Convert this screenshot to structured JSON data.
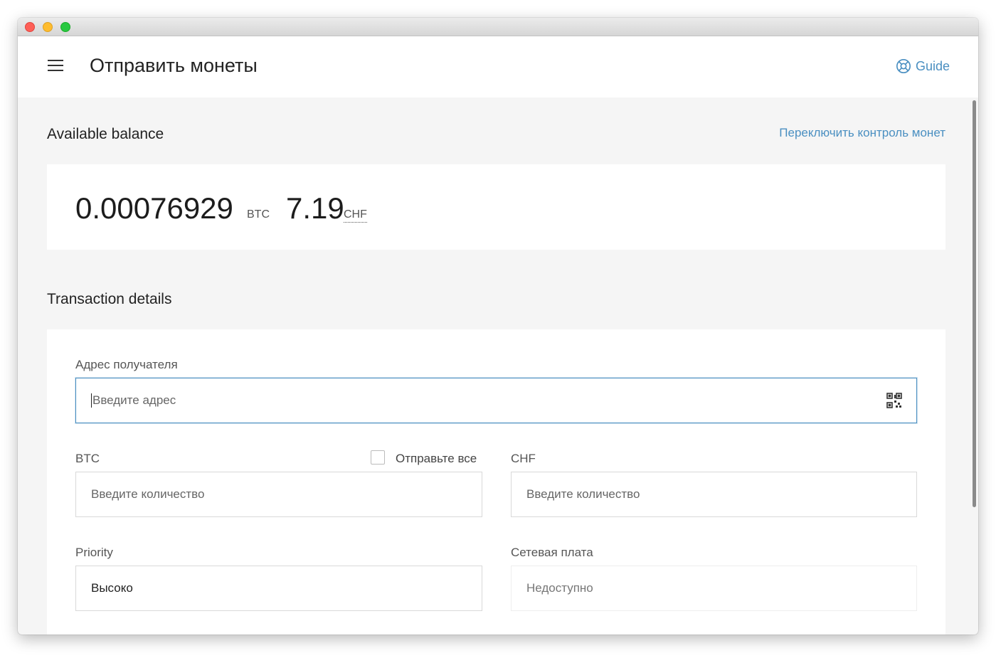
{
  "header": {
    "title": "Отправить монеты",
    "guide_label": "Guide"
  },
  "balance": {
    "section_title": "Available balance",
    "switch_coin_control": "Переключить контроль монет",
    "btc_amount": "0.00076929",
    "btc_unit": "BTC",
    "fiat_amount": "7.19",
    "fiat_unit": "CHF"
  },
  "transaction": {
    "section_title": "Transaction details",
    "recipient": {
      "label": "Адрес получателя",
      "placeholder": "Введите адрес"
    },
    "btc": {
      "label": "BTC",
      "send_all_label": "Отправьте все",
      "placeholder": "Введите количество"
    },
    "fiat": {
      "label": "CHF",
      "placeholder": "Введите количество"
    },
    "priority": {
      "label": "Priority",
      "value": "Высоко"
    },
    "fee": {
      "label": "Сетевая плата",
      "value": "Недоступно"
    }
  },
  "colors": {
    "accent": "#4a8fc1",
    "background": "#f5f5f5",
    "card": "#ffffff"
  },
  "icons": {
    "menu": "menu-icon",
    "guide": "lifebuoy-icon",
    "qr": "qr-code-icon"
  }
}
